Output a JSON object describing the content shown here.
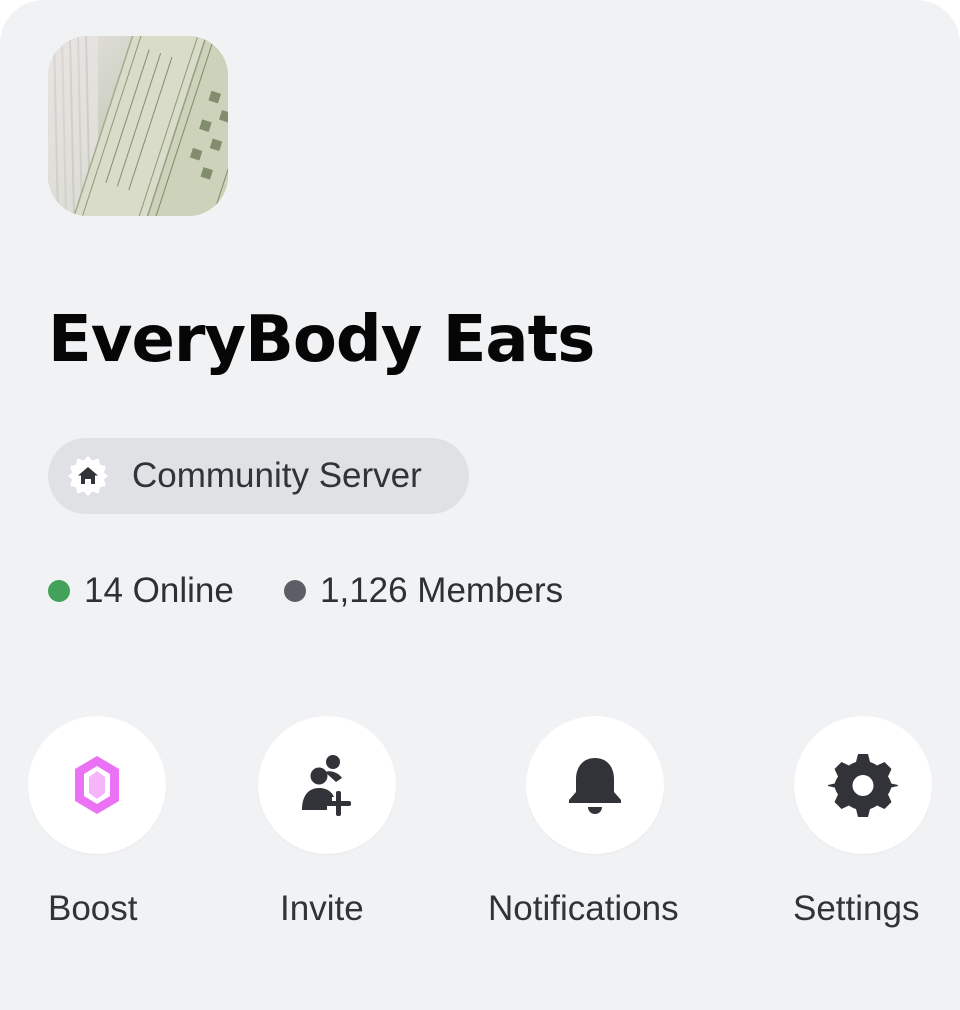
{
  "server": {
    "name": "EveryBody Eats",
    "icon": "server-banknotes-image",
    "badge": {
      "icon": "community-home-icon",
      "label": "Community Server"
    }
  },
  "stats": {
    "online": {
      "label": "14 Online",
      "color": "#43a25a"
    },
    "members": {
      "label": "1,126 Members",
      "color": "#5c5e66"
    }
  },
  "actions": [
    {
      "label": "Boost",
      "icon": "boost-gem-icon",
      "color": "#eb72f4"
    },
    {
      "label": "Invite",
      "icon": "invite-person-add-icon",
      "color": "#313338"
    },
    {
      "label": "Notifications",
      "icon": "bell-icon",
      "color": "#313338"
    },
    {
      "label": "Settings",
      "icon": "gear-icon",
      "color": "#313338"
    }
  ]
}
